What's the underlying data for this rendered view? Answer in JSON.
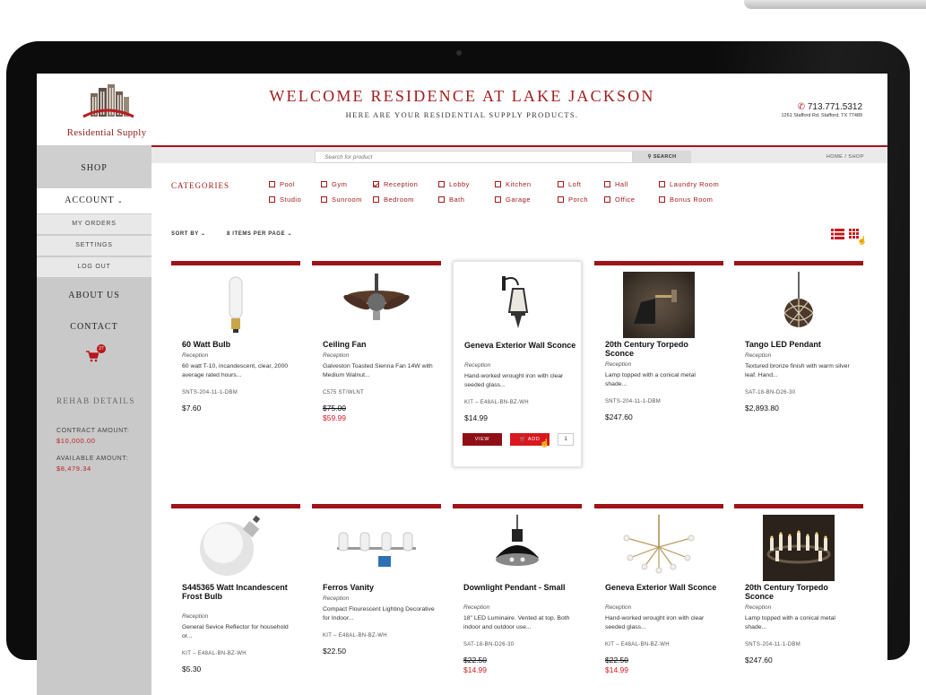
{
  "brand": {
    "name": "Residential Supply",
    "colors": {
      "accent": "#a01c1c",
      "bar": "#9e1218",
      "sale": "#d11a1f",
      "sidebar": "#c9c9ca"
    }
  },
  "header": {
    "title": "WELCOME RESIDENCE AT LAKE JACKSON",
    "subtitle": "HERE ARE YOUR RESIDENTIAL SUPPLY PRODUCTS.",
    "phone": "713.771.5312",
    "address": "1261 Stafford Rd. Stafford, TX 77489"
  },
  "sidebar": {
    "shop": "SHOP",
    "account": "ACCOUNT",
    "account_menu": [
      "MY ORDERS",
      "SETTINGS",
      "LOG OUT"
    ],
    "about": "ABOUT US",
    "contact": "CONTACT",
    "cart_count": "27",
    "rehab_title": "REHAB DETAILS",
    "contract_label": "CONTRACT AMOUNT:",
    "contract_value": "$10,000.00",
    "available_label": "AVAILABLE AMOUNT:",
    "available_value": "$8,479.34"
  },
  "search": {
    "placeholder": "Search for product",
    "button": "SEARCH",
    "breadcrumb": "HOME  /  SHOP"
  },
  "categories": {
    "title": "CATEGORIES",
    "items": [
      {
        "label": "Pool",
        "checked": false
      },
      {
        "label": "Gym",
        "checked": false
      },
      {
        "label": "Reception",
        "checked": true
      },
      {
        "label": "Lobby",
        "checked": false
      },
      {
        "label": "Kitchen",
        "checked": false
      },
      {
        "label": "Loft",
        "checked": false
      },
      {
        "label": "Hall",
        "checked": false
      },
      {
        "label": "Laundry Room",
        "checked": false
      },
      {
        "label": "Studio",
        "checked": false
      },
      {
        "label": "Sunroom",
        "checked": false
      },
      {
        "label": "Bedroom",
        "checked": false
      },
      {
        "label": "Bath",
        "checked": false
      },
      {
        "label": "Garage",
        "checked": false
      },
      {
        "label": "Porch",
        "checked": false
      },
      {
        "label": "Office",
        "checked": false
      },
      {
        "label": "Bonus Room",
        "checked": false
      }
    ]
  },
  "toolbar": {
    "sort_by": "SORT BY",
    "per_page": "8 ITEMS PER PAGE",
    "view_list_icon": "list-view-icon",
    "view_grid_icon": "grid-view-icon"
  },
  "products": [
    {
      "name": "60 Watt Bulb",
      "category": "Reception",
      "desc": "60 watt T-10, incandescent, clear, 2000 average rated hours...",
      "sku": "SNTS-204-11-1-DBM",
      "price": "$7.60",
      "old_price": "",
      "image": "bulb-image"
    },
    {
      "name": "Ceiling Fan",
      "category": "Reception",
      "desc": "Galveston Toasted Sienna Fan 14W with Medium Walnut...",
      "sku": "C575 ST/WLNT",
      "price": "$59.99",
      "old_price": "$75.00",
      "image": "fan-image"
    },
    {
      "name": "Geneva Exterior Wall Sconce",
      "category": "Reception",
      "desc": "Hand-worked wrought iron with clear seeded glass...",
      "sku": "KIT – E48AL-BN-BZ-WH",
      "price": "$14.99",
      "old_price": "",
      "image": "lantern-image",
      "view_label": "VIEW",
      "add_label": "ADD",
      "qty": "1"
    },
    {
      "name": "20th Century Torpedo Sconce",
      "category": "Reception",
      "desc": "Lamp topped with a conical metal shade...",
      "sku": "SNTS-204-11-1-DBM",
      "price": "$247.60",
      "old_price": "",
      "image": "sconce-image"
    },
    {
      "name": "Tango LED Pendant",
      "category": "Reception",
      "desc": "Textured bronze finish with warm silver leaf. Hand...",
      "sku": "SAT-18-BN-D26-30",
      "price": "$2,893.80",
      "old_price": "",
      "image": "pendant-ball-image"
    },
    {
      "name": "S445365 Watt Incandescent Frost Bulb",
      "category": "Reception",
      "desc": "General Sevice Reflector for household or...",
      "sku": "KIT – E48AL-BN-BZ-WH",
      "price": "$5.30",
      "old_price": "",
      "image": "frost-bulb-image"
    },
    {
      "name": "Ferros Vanity",
      "category": "Reception",
      "desc": "Compact Flourescent Lighting Decorative for Indoor...",
      "sku": "KIT – E48AL-BN-BZ-WH",
      "price": "$22.50",
      "old_price": "",
      "image": "vanity-image"
    },
    {
      "name": "Downlight Pendant - Small",
      "category": "Reception",
      "desc": "18\" LED Luminaire. Vented at top. Both indoor and outdoor use...",
      "sku": "SAT-18-BN-D26-30",
      "price": "$14.99",
      "old_price": "$22.50",
      "image": "downlight-image"
    },
    {
      "name": "Geneva Exterior Wall Sconce",
      "category": "Reception",
      "desc": "Hand-worked wrought iron with clear seeded glass...",
      "sku": "KIT – E48AL-BN-BZ-WH",
      "price": "$14.99",
      "old_price": "$22.50",
      "image": "chandelier-image"
    },
    {
      "name": "20th Century Torpedo Sconce",
      "category": "Reception",
      "desc": "Lamp topped with a conical metal shade...",
      "sku": "SNTS-204-11-1-DBM",
      "price": "$247.60",
      "old_price": "",
      "image": "candle-chandelier-image"
    }
  ]
}
